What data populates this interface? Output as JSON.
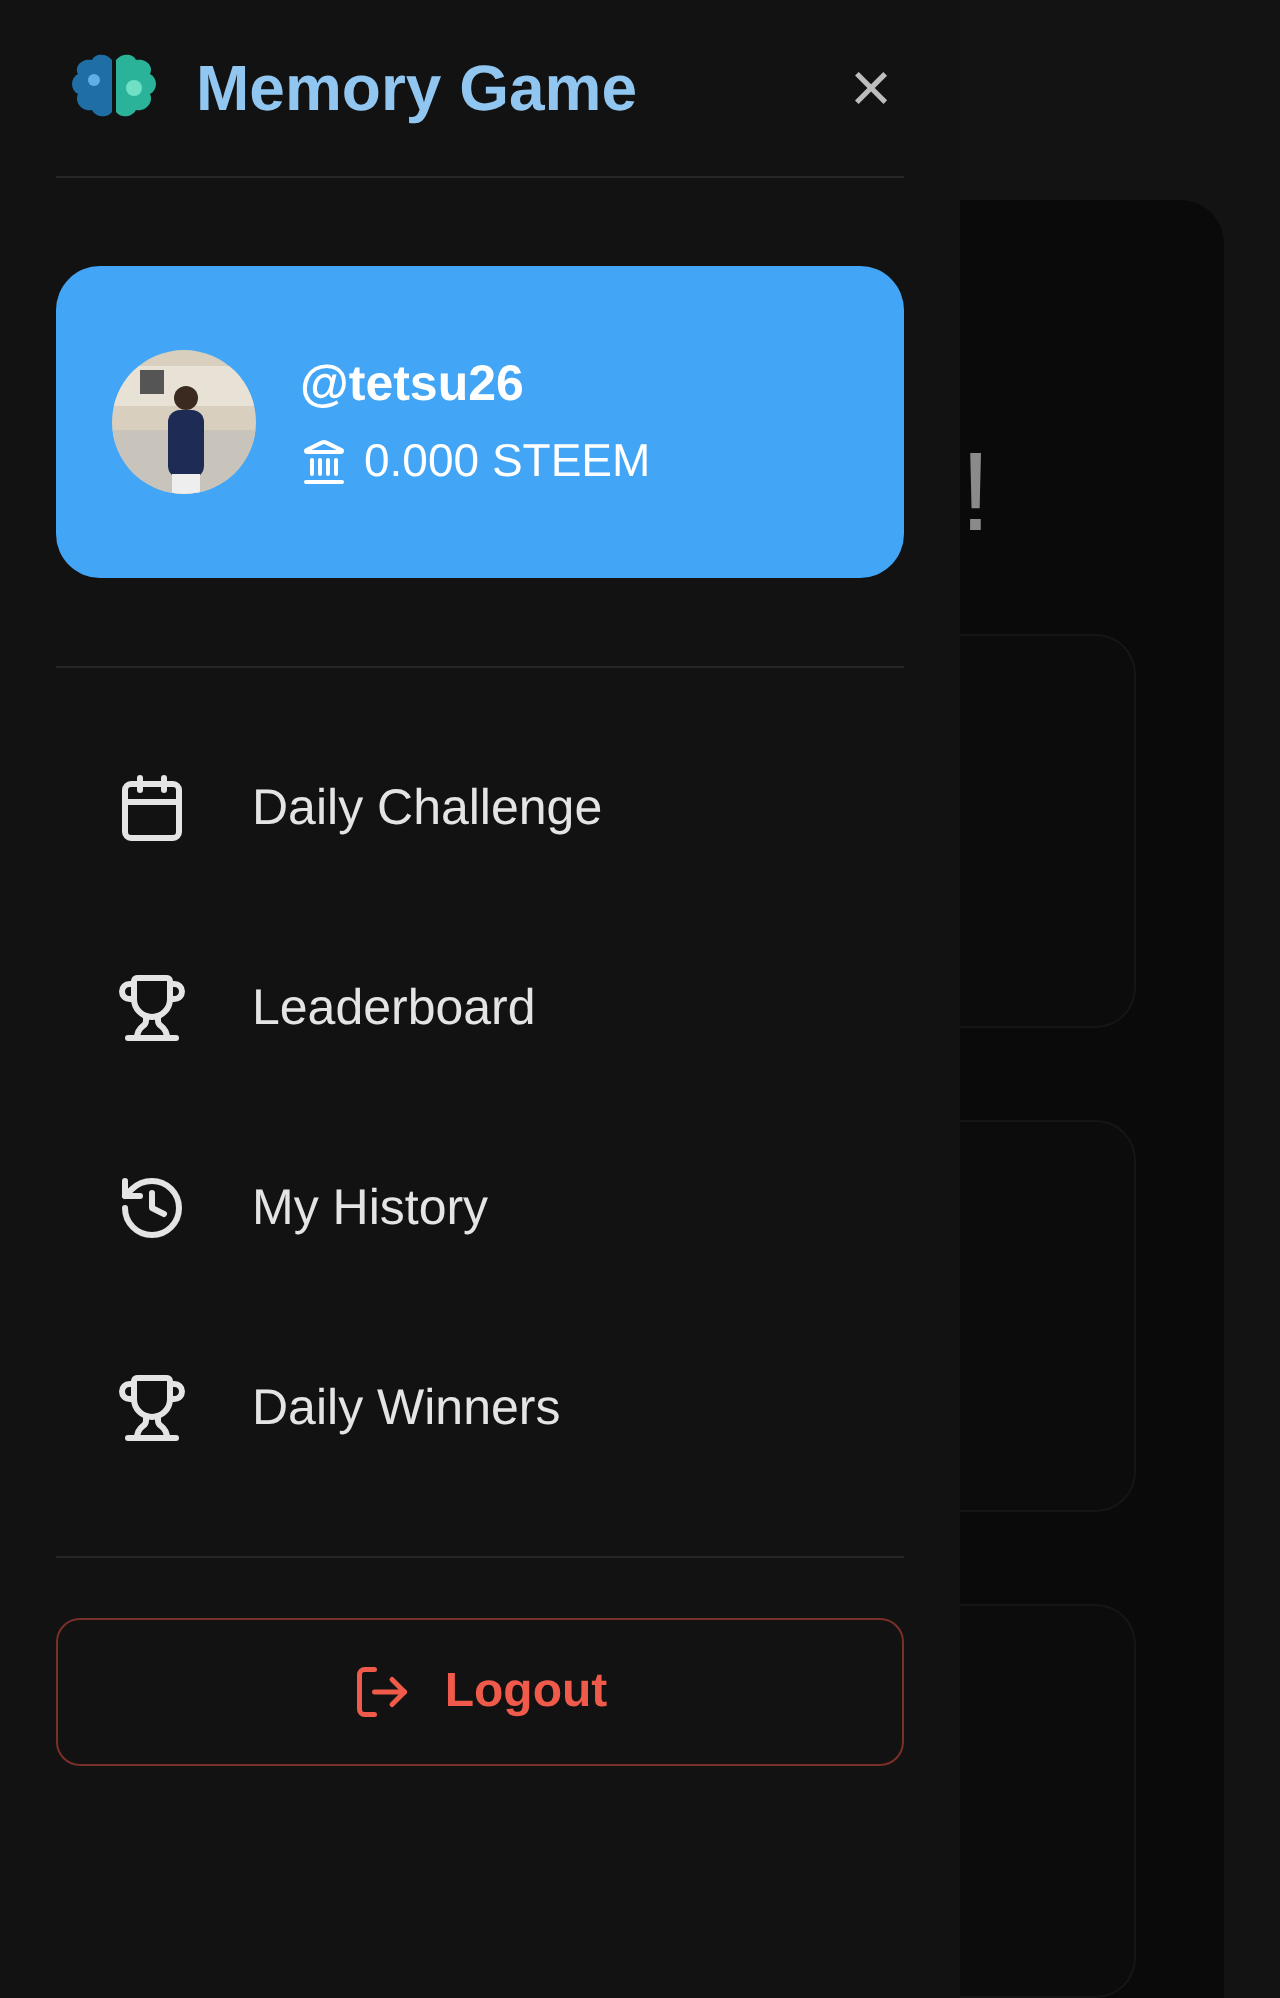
{
  "drawer": {
    "title": "Memory Game",
    "close": "×",
    "profile": {
      "username": "@tetsu26",
      "balance": "0.000 STEEM"
    },
    "menu": [
      {
        "kind": "calendar",
        "label": "Daily Challenge"
      },
      {
        "kind": "trophy",
        "label": "Leaderboard"
      },
      {
        "kind": "history",
        "label": "My History"
      },
      {
        "kind": "trophy",
        "label": "Daily Winners"
      }
    ],
    "logout": "Logout"
  },
  "background": {
    "heading_fragment": "!"
  }
}
